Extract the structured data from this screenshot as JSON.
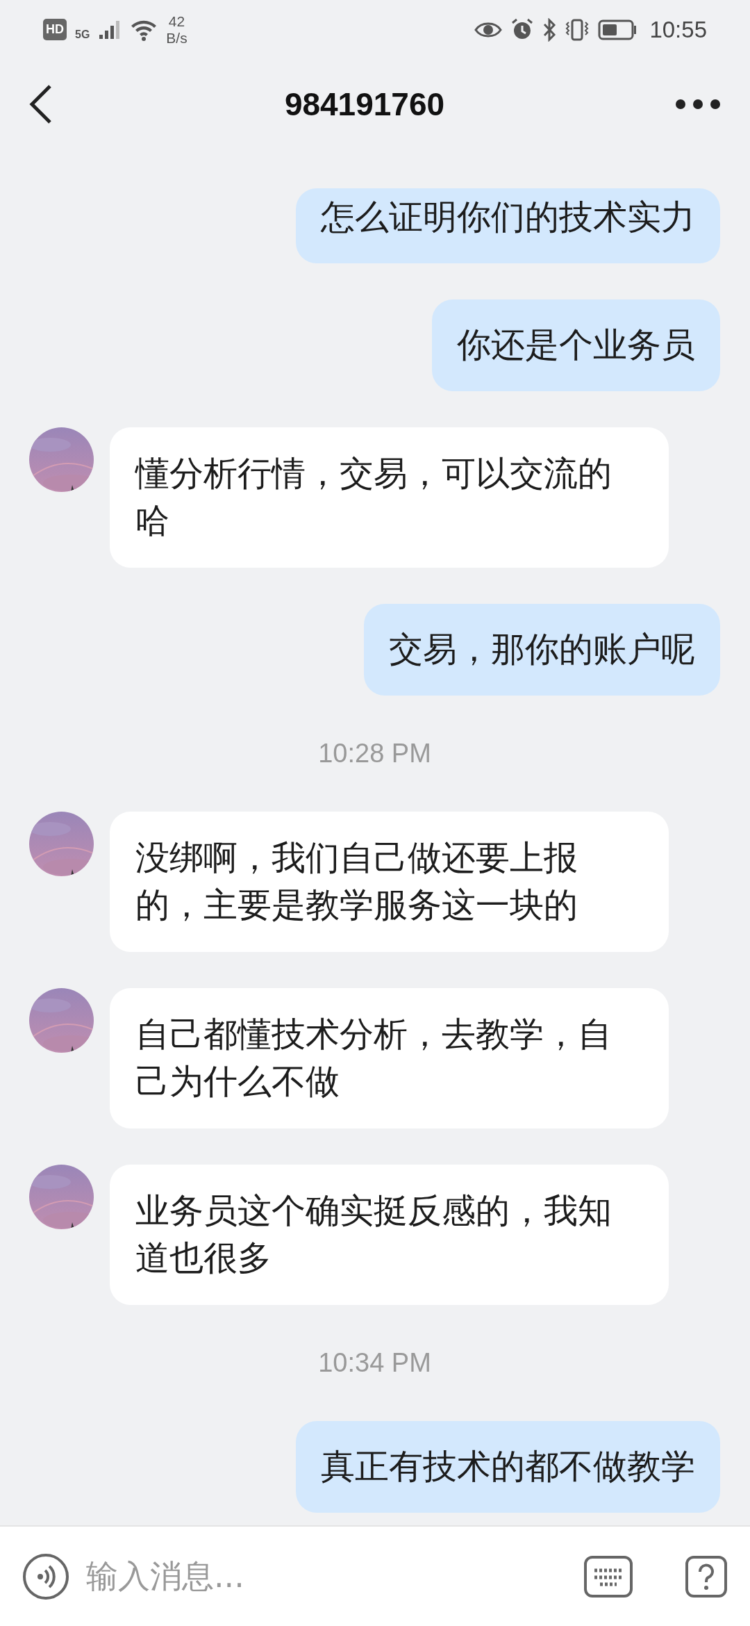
{
  "status_bar": {
    "hd_label": "HD",
    "network_label": "5G",
    "speed_value": "42",
    "speed_unit": "B/s",
    "time": "10:55"
  },
  "header": {
    "title": "984191760"
  },
  "messages": [
    {
      "kind": "sent",
      "text": "怎么证明你们的技术实力"
    },
    {
      "kind": "sent",
      "text": "你还是个业务员"
    },
    {
      "kind": "received",
      "text": "懂分析行情，交易，可以交流的哈"
    },
    {
      "kind": "sent",
      "text": "交易，那你的账户呢"
    },
    {
      "kind": "time",
      "text": "10:28 PM"
    },
    {
      "kind": "received",
      "text": "没绑啊，我们自己做还要上报的，主要是教学服务这一块的"
    },
    {
      "kind": "received",
      "text": "自己都懂技术分析，去教学，自己为什么不做"
    },
    {
      "kind": "received",
      "text": "业务员这个确实挺反感的，我知道也很多"
    },
    {
      "kind": "time",
      "text": "10:34 PM"
    },
    {
      "kind": "sent",
      "text": "真正有技术的都不做教学"
    }
  ],
  "input_bar": {
    "placeholder": "输入消息..."
  }
}
